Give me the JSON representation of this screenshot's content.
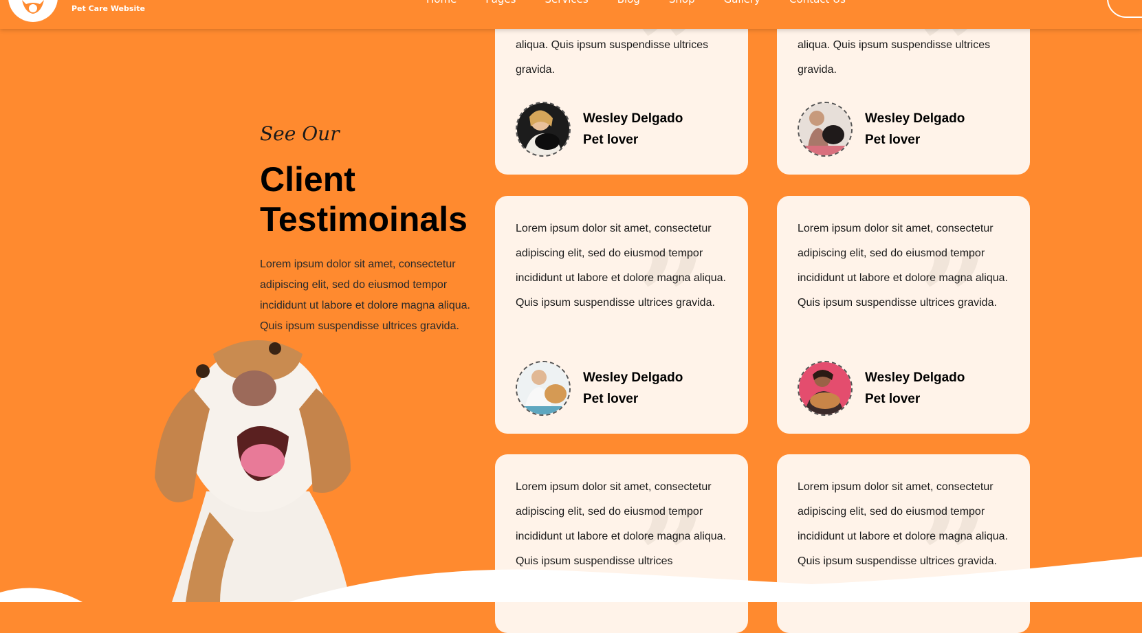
{
  "header": {
    "brand_sub": "Pet Care Website",
    "nav": [
      "Home",
      "Pages",
      "Services",
      "Blog",
      "Shop",
      "Gallery",
      "Contact Us"
    ]
  },
  "section": {
    "eyebrow": "See Our",
    "title": "Client Testimoinals",
    "intro": "Lorem ipsum dolor sit amet, consectetur adipiscing elit, sed do eiusmod tempor incididunt ut labore et dolore magna aliqua. Quis ipsum suspendisse ultrices gravida."
  },
  "testimonials": [
    {
      "text": "aliqua. Quis ipsum suspendisse ultrices gravida.",
      "name": "Wesley Delgado",
      "role": "Pet lover",
      "avatar": "woman-holding-cat-photo"
    },
    {
      "text": "aliqua. Quis ipsum suspendisse ultrices gravida.",
      "name": "Wesley Delgado",
      "role": "Pet lover",
      "avatar": "woman-with-dog-photo"
    },
    {
      "text": "Lorem ipsum dolor sit amet, consectetur adipiscing elit, sed do eiusmod tempor incididunt ut labore et dolore magna aliqua. Quis ipsum suspendisse ultrices gravida.",
      "name": "Wesley Delgado",
      "role": "Pet lover",
      "avatar": "vet-with-dog-photo"
    },
    {
      "text": "Lorem ipsum dolor sit amet, consectetur adipiscing elit, sed do eiusmod tempor incididunt ut labore et dolore magna aliqua. Quis ipsum suspendisse ultrices gravida.",
      "name": "Wesley Delgado",
      "role": "Pet lover",
      "avatar": "woman-hugging-dog-photo"
    },
    {
      "text": "Lorem ipsum dolor sit amet, consectetur adipiscing elit, sed do eiusmod tempor incididunt ut labore et dolore magna aliqua. Quis ipsum suspendisse ultrices",
      "name": "",
      "role": "",
      "avatar": ""
    },
    {
      "text": "Lorem ipsum dolor sit amet, consectetur adipiscing elit, sed do eiusmod tempor incididunt ut labore et dolore magna aliqua. Quis ipsum suspendisse ultrices gravida.",
      "name": "",
      "role": "",
      "avatar": ""
    }
  ],
  "colors": {
    "accent": "#ff8a2f",
    "card_bg": "#fff3e9",
    "text": "#000000"
  }
}
